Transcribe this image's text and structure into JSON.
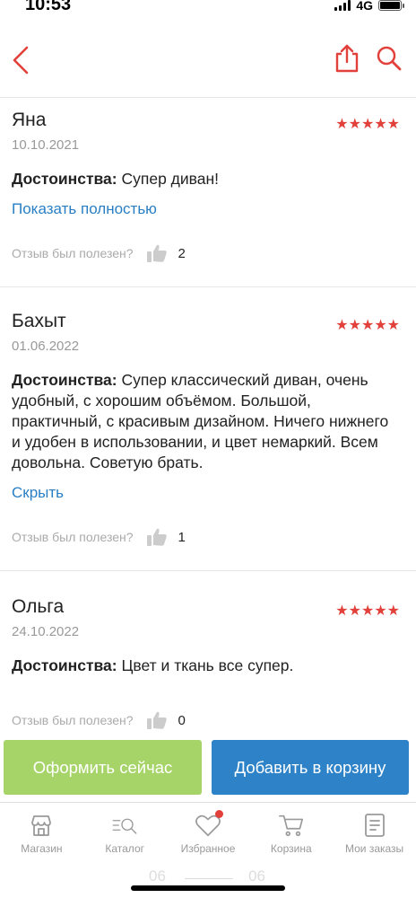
{
  "status_bar": {
    "time": "10:53",
    "network": "4G"
  },
  "colors": {
    "accent_red": "#e2413b",
    "link_blue": "#2a7fc4",
    "order_green": "#a6d468",
    "cart_blue": "#2d82c8"
  },
  "top_bar": {
    "back_icon": "chevron-left-icon",
    "share_icon": "share-icon",
    "search_icon": "search-icon"
  },
  "reviews": [
    {
      "name": "Яна",
      "date": "10.10.2021",
      "rating": 5,
      "stars": "★★★★★",
      "pros_label": "Достоинства:",
      "pros_text": " Супер диван!",
      "toggle_label": "Показать полностью",
      "helpful_label": "Отзыв был полезен?",
      "helpful_count": "2"
    },
    {
      "name": "Бахыт",
      "date": "01.06.2022",
      "rating": 5,
      "stars": "★★★★★",
      "pros_label": "Достоинства:",
      "pros_text": " Супер классический диван, очень удобный, с хорошим объёмом. Большой, практичный, с красивым дизайном. Ничего нижнего и удобен в использовании, и цвет немаркий. Всем довольна. Советую брать.",
      "toggle_label": "Скрыть",
      "helpful_label": "Отзыв был полезен?",
      "helpful_count": "1"
    },
    {
      "name": "Ольга",
      "date": "24.10.2022",
      "rating": 5,
      "stars": "★★★★★",
      "pros_label": "Достоинства:",
      "pros_text": " Цвет и ткань все супер.",
      "helpful_label": "Отзыв был полезен?",
      "helpful_count": "0"
    }
  ],
  "actions": {
    "order_now": "Оформить сейчас",
    "add_to_cart": "Добавить в корзину"
  },
  "tabs": [
    {
      "label": "Магазин",
      "icon": "store-icon"
    },
    {
      "label": "Каталог",
      "icon": "catalog-search-icon"
    },
    {
      "label": "Избранное",
      "icon": "heart-icon"
    },
    {
      "label": "Корзина",
      "icon": "cart-icon"
    },
    {
      "label": "Мои заказы",
      "icon": "orders-icon"
    }
  ],
  "faded_footer": {
    "left": "06",
    "right": "06"
  }
}
